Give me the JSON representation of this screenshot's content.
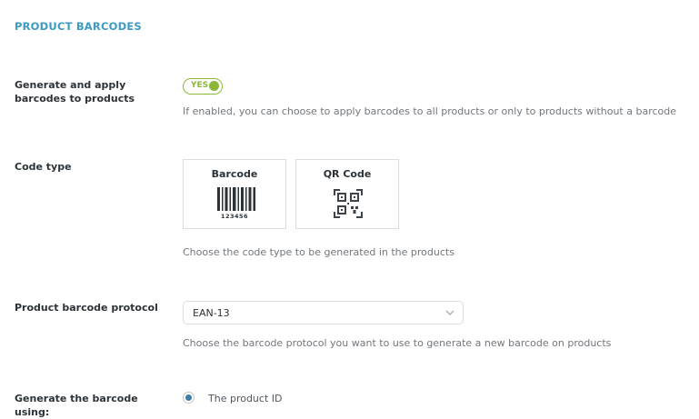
{
  "section": {
    "title": "PRODUCT BARCODES"
  },
  "generate": {
    "label": "Generate and apply barcodes to products",
    "toggle_text": "YES",
    "description": "If enabled, you can choose to apply barcodes to all products or only to products without a barcode",
    "accent_color": "#8db739"
  },
  "code_type": {
    "label": "Code type",
    "options": [
      {
        "title": "Barcode",
        "sample_number": "123456",
        "icon": "barcode-icon"
      },
      {
        "title": "QR Code",
        "icon": "qr-code-icon"
      }
    ],
    "description": "Choose the code type to be generated in the products"
  },
  "protocol": {
    "label": "Product barcode protocol",
    "value": "EAN-13",
    "description": "Choose the barcode protocol you want to use to generate a new barcode on products"
  },
  "generate_using": {
    "label": "Generate the barcode using:",
    "option_label": "The product ID",
    "accent_color": "#3d7ea6"
  }
}
